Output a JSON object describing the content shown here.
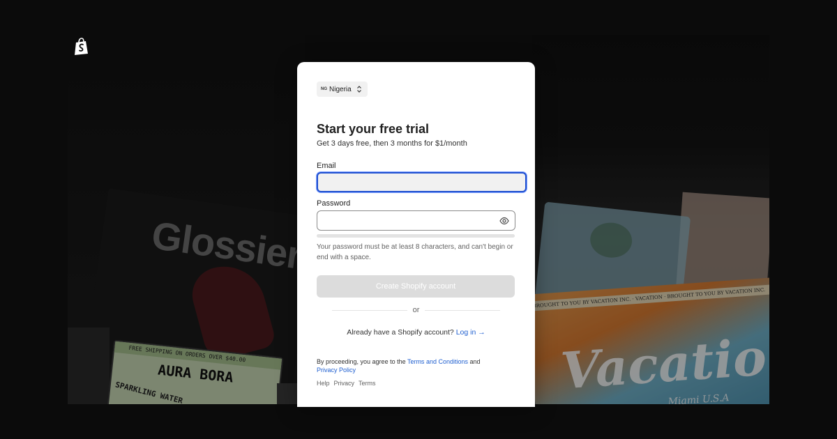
{
  "background": {
    "glossier_text": "Glossier.",
    "aura_strip": "FREE SHIPPING ON ORDERS OVER $40.00",
    "aura_brand": "AURA BORA",
    "aura_sub": "SPARKLING WATER",
    "vacation_strip": "BROUGHT TO YOU BY VACATION INC. · VACATION · BROUGHT TO YOU BY VACATION INC.",
    "vacation_brand": "Vacation",
    "vacation_sub": "Miami U.S.A"
  },
  "signup": {
    "country": {
      "code": "NG",
      "name": "Nigeria"
    },
    "title": "Start your free trial",
    "subtitle": "Get 3 days free, then 3 months for $1/month",
    "email": {
      "label": "Email",
      "value": "",
      "placeholder": ""
    },
    "password": {
      "label": "Password",
      "value": "",
      "placeholder": ""
    },
    "password_hint": "Your password must be at least 8 characters, and can't begin or end with a space.",
    "create_button": "Create Shopify account",
    "divider": "or",
    "login_prompt": "Already have a Shopify account?",
    "login_link": "Log in →",
    "legal_prefix": "By proceeding, you agree to the",
    "terms_link": "Terms and Conditions",
    "legal_and": "and",
    "privacy_link": "Privacy Policy",
    "footer": {
      "help": "Help",
      "privacy": "Privacy",
      "terms": "Terms"
    }
  },
  "colors": {
    "accent": "#1f5fd0",
    "focus_border": "#1f4fd0",
    "disabled_button": "#dcdcdc",
    "backdrop": "#0b0b0b"
  },
  "icons": {
    "brand": "shopify-bag-icon",
    "country": "chevron-up-down-icon",
    "password_toggle": "eye-icon"
  }
}
